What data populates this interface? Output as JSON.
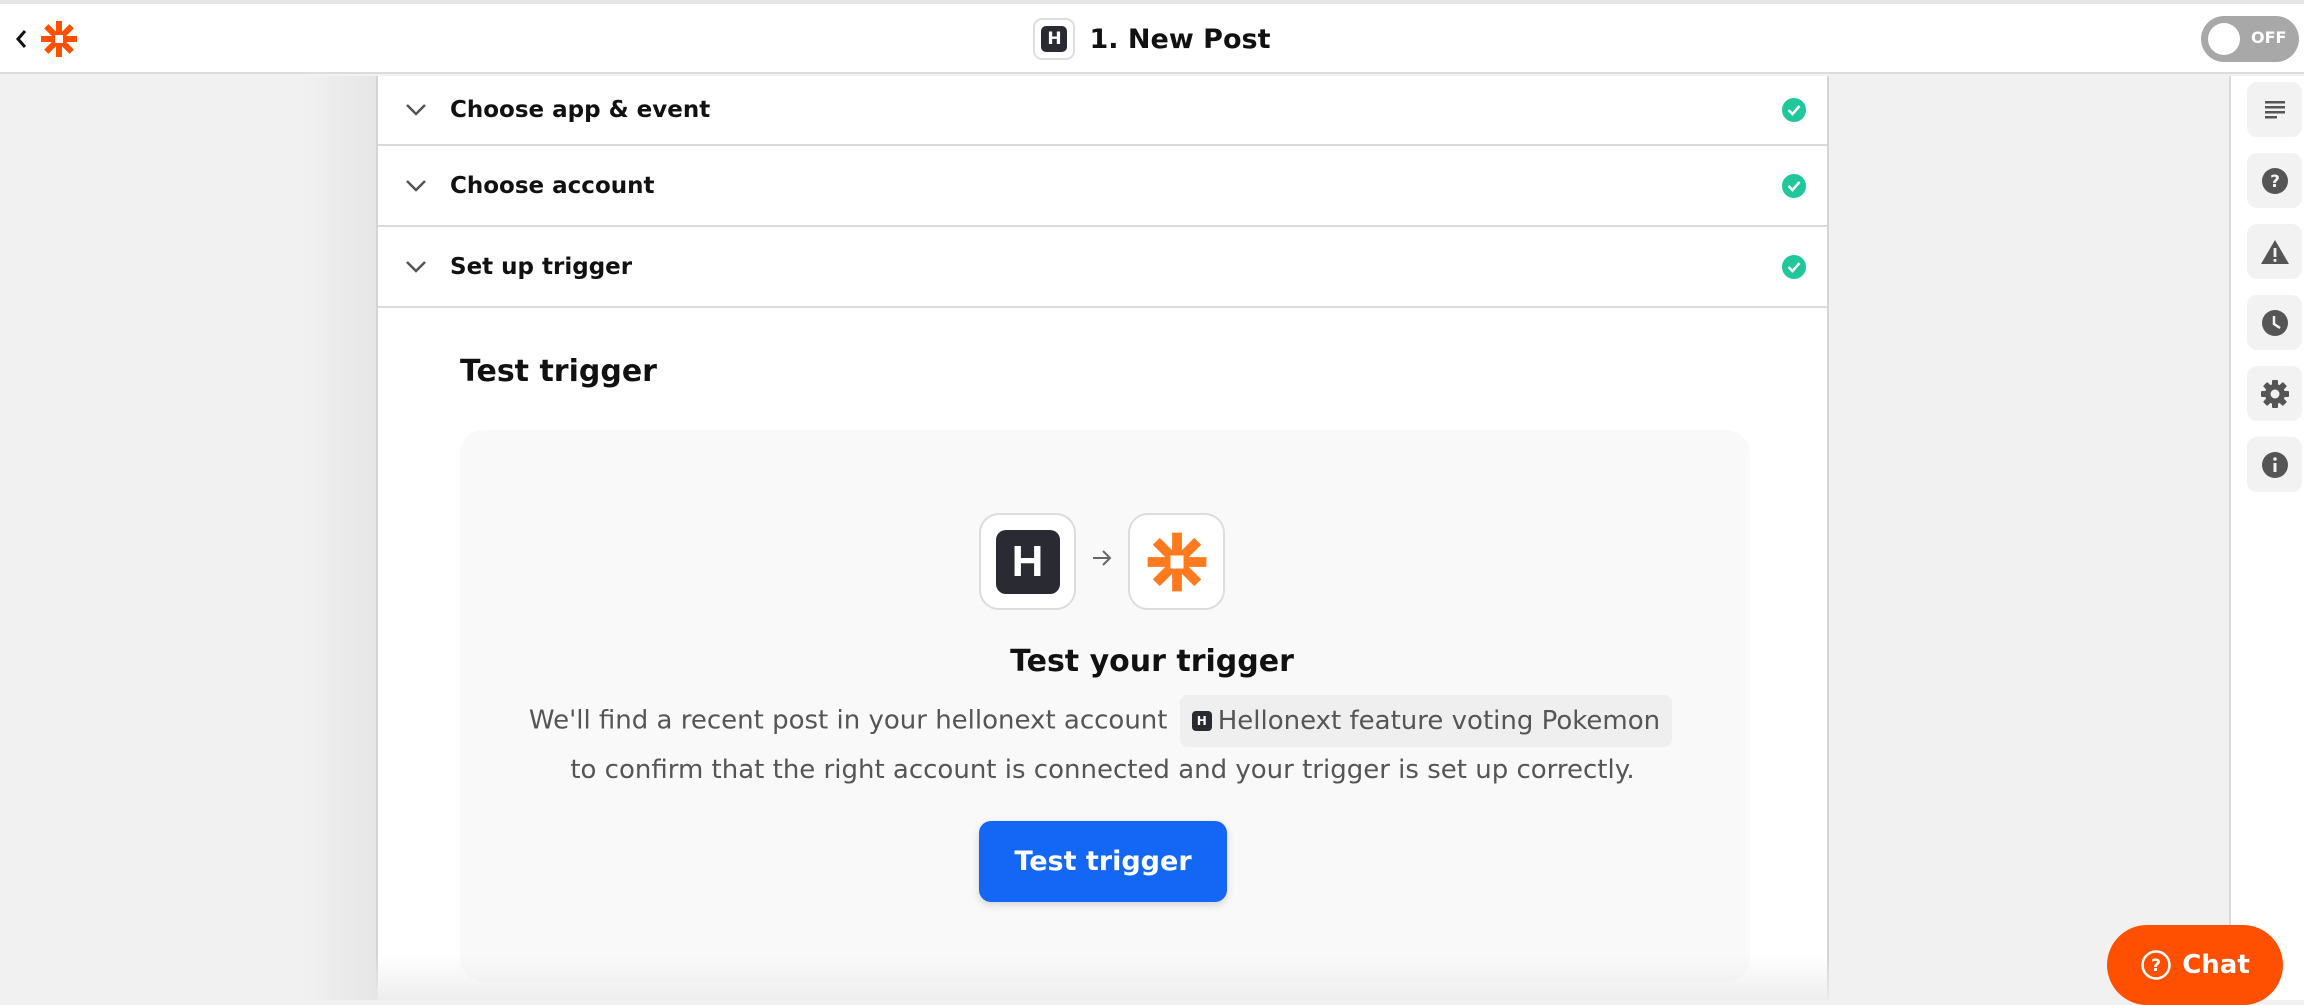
{
  "header": {
    "title": "1. New Post",
    "app_badge_letter": "H",
    "toggle_label": "OFF",
    "toggle_state": "off"
  },
  "steps": [
    {
      "label": "Choose app & event",
      "status": "complete"
    },
    {
      "label": "Choose account",
      "status": "complete"
    },
    {
      "label": "Set up trigger",
      "status": "complete"
    }
  ],
  "test_section": {
    "title": "Test trigger",
    "source_app_letter": "H",
    "panel_title": "Test your trigger",
    "description_before": "We'll find a recent post in your hellonext account",
    "account_pill_letter": "H",
    "account_name": "Hellonext feature voting Pokemon",
    "description_after": "to confirm that the right account is connected and your trigger is set up correctly.",
    "button_label": "Test trigger"
  },
  "sidebar": {
    "items": [
      {
        "icon": "outline-icon"
      },
      {
        "icon": "help-icon"
      },
      {
        "icon": "warning-icon"
      },
      {
        "icon": "history-icon"
      },
      {
        "icon": "settings-icon"
      },
      {
        "icon": "info-icon"
      }
    ]
  },
  "chat": {
    "label": "Chat"
  },
  "colors": {
    "brand_orange": "#ff4f00",
    "primary_blue": "#1466f5",
    "success_green": "#1fc79a",
    "app_dark": "#2a2a33"
  }
}
